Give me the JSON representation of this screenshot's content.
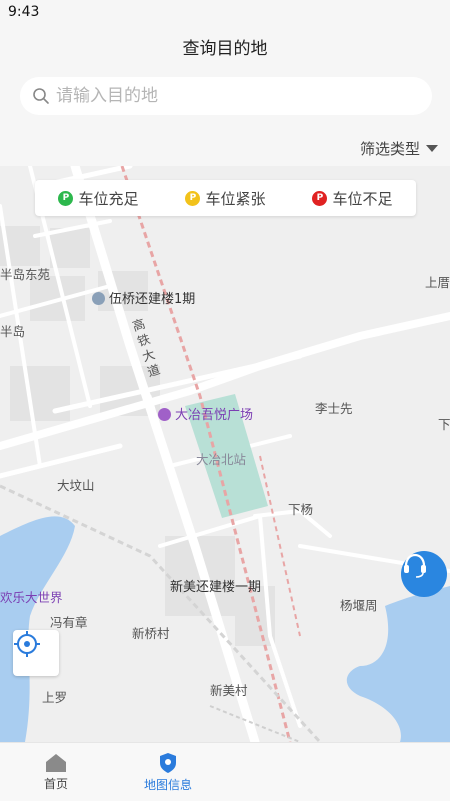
{
  "status_bar": {
    "time": "9:43"
  },
  "header": {
    "title": "查询目的地"
  },
  "search": {
    "placeholder": "请输入目的地"
  },
  "filter": {
    "label": "筛选类型"
  },
  "legend": [
    {
      "label": "车位充足",
      "color": "#2db84d",
      "icon": "P"
    },
    {
      "label": "车位紧张",
      "color": "#f2c21b",
      "icon": "P"
    },
    {
      "label": "车位不足",
      "color": "#e02222",
      "icon": "P"
    }
  ],
  "map": {
    "labels": {
      "shangcuo": "上厝",
      "bandao_dongyuan": "半岛东苑",
      "wuqiao": "伍桥还建楼1期",
      "bandao": "半岛",
      "gaotie_road": "高铁大道",
      "daye_wuyue": "大冶吾悦广场",
      "lishixian": "李士先",
      "xia": "下",
      "daye_north": "大冶北站",
      "dafenshan": "大坟山",
      "xiayang": "下杨",
      "xinmei_huanjian": "新美还建楼一期",
      "huanle": "欢乐大世界",
      "fengyouzhang": "冯有章",
      "yangyanzhou": "杨堰周",
      "xinqiao": "新桥村",
      "shangluo": "上罗",
      "xinmei": "新美村"
    }
  },
  "tabs": [
    {
      "label": "首页",
      "icon": "home-icon",
      "active": false
    },
    {
      "label": "地图信息",
      "icon": "map-pin-icon",
      "active": true
    }
  ],
  "colors": {
    "accent": "#2a7bdc",
    "support": "#2a86e0",
    "water": "#a9cdf0",
    "station": "#b8e0d6",
    "rail": "#e8a5a5"
  }
}
